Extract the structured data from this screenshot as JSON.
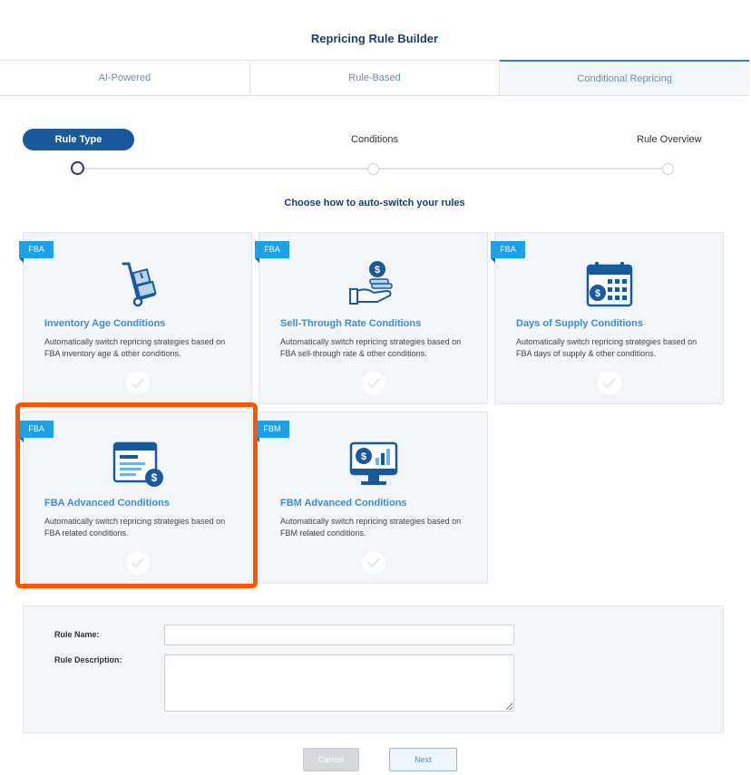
{
  "page": {
    "title": "Repricing Rule Builder"
  },
  "tabs": [
    {
      "label": "AI-Powered",
      "active": false
    },
    {
      "label": "Rule-Based",
      "active": false
    },
    {
      "label": "Conditional Repricing",
      "active": true
    }
  ],
  "stepper": {
    "steps": [
      {
        "label": "Rule Type",
        "active": true
      },
      {
        "label": "Conditions",
        "active": false
      },
      {
        "label": "Rule Overview",
        "active": false
      }
    ]
  },
  "heading": "Choose how to auto-switch your rules",
  "cards": [
    {
      "badge": "FBA",
      "icon": "hand-truck-boxes-icon",
      "title": "Inventory Age Conditions",
      "description": "Automatically switch repricing strategies based on FBA inventory age & other conditions."
    },
    {
      "badge": "FBA",
      "icon": "hand-coins-icon",
      "title": "Sell-Through Rate Conditions",
      "description": "Automatically switch repricing strategies based on FBA sell-through rate & other conditions."
    },
    {
      "badge": "FBA",
      "icon": "calendar-dollar-icon",
      "title": "Days of Supply Conditions",
      "description": "Automatically switch repricing strategies based on FBA days of supply & other conditions."
    },
    {
      "badge": "FBA",
      "icon": "document-dollar-icon",
      "title": "FBA Advanced Conditions",
      "description": "Automatically switch repricing strategies based on FBA related conditions.",
      "highlighted": true
    },
    {
      "badge": "FBM",
      "icon": "monitor-chart-icon",
      "title": "FBM Advanced Conditions",
      "description": "Automatically switch repricing strategies based on FBM related conditions."
    }
  ],
  "form": {
    "rule_name_label": "Rule Name:",
    "rule_name_value": "",
    "rule_description_label": "Rule Description:",
    "rule_description_value": ""
  },
  "buttons": {
    "cancel": "Cancel",
    "next": "Next"
  },
  "colors": {
    "accent": "#1ea0e6",
    "primary": "#1a5a9c",
    "highlight": "#ff5500"
  }
}
